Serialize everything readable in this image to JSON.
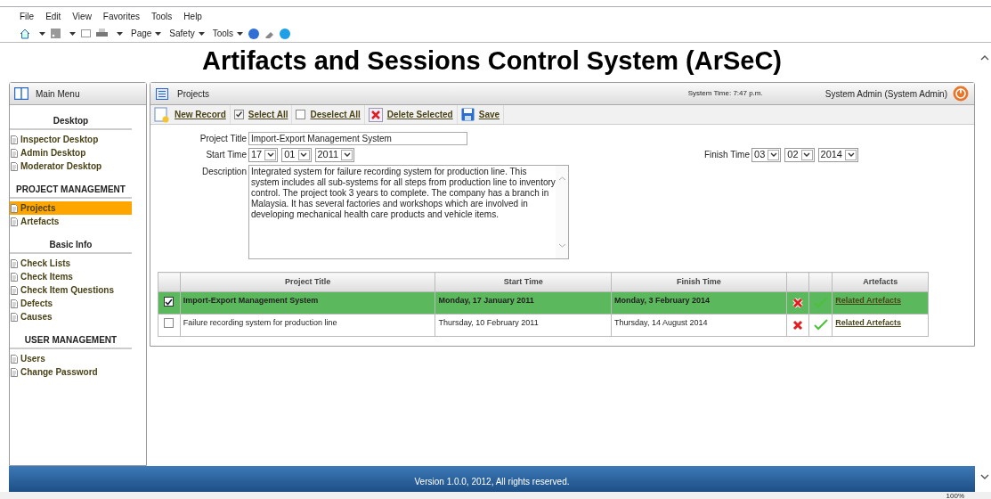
{
  "browser": {
    "menu": [
      "File",
      "Edit",
      "View",
      "Favorites",
      "Tools",
      "Help"
    ],
    "toolbar": [
      "Page",
      "Safety",
      "Tools"
    ],
    "zoom": "100%"
  },
  "page_title": "Artifacts and Sessions Control System (ArSeC)",
  "sidebar": {
    "title": "Main Menu",
    "sections": [
      {
        "heading": "Desktop",
        "items": [
          {
            "label": "Inspector Desktop",
            "selected": false
          },
          {
            "label": "Admin Desktop",
            "selected": false
          },
          {
            "label": "Moderator Desktop",
            "selected": false
          }
        ]
      },
      {
        "heading": "PROJECT MANAGEMENT",
        "items": [
          {
            "label": "Projects",
            "selected": true
          },
          {
            "label": "Artefacts",
            "selected": false
          }
        ]
      },
      {
        "heading": "Basic Info",
        "items": [
          {
            "label": "Check Lists",
            "selected": false
          },
          {
            "label": "Check Items",
            "selected": false
          },
          {
            "label": "Check Item Questions",
            "selected": false
          },
          {
            "label": "Defects",
            "selected": false
          },
          {
            "label": "Causes",
            "selected": false
          }
        ]
      },
      {
        "heading": "USER MANAGEMENT",
        "items": [
          {
            "label": "Users",
            "selected": false
          },
          {
            "label": "Change Password",
            "selected": false
          }
        ]
      }
    ]
  },
  "panel": {
    "title": "Projects",
    "system_time": "System Time: 7:47 p.m.",
    "user": "System Admin (System Admin)"
  },
  "actions": [
    {
      "kind": "new",
      "label": "New Record"
    },
    {
      "kind": "select",
      "label": "Select All"
    },
    {
      "kind": "deselect",
      "label": "Deselect All"
    },
    {
      "kind": "delete",
      "label": "Delete Selected"
    },
    {
      "kind": "save",
      "label": "Save"
    }
  ],
  "form": {
    "title_label": "Project Title",
    "title_value": "Import-Export Management System",
    "start_label": "Start Time",
    "start": [
      "17",
      "01",
      "2011"
    ],
    "finish_label": "Finish Time",
    "finish": [
      "03",
      "02",
      "2014"
    ],
    "description_label": "Description",
    "description": "Integrated system for failure recording system for production line. This system includes all sub-systems for all steps from production line to inventory control. The project took 3 years to complete. The company has a branch in Malaysia. It has several factories and workshops which are involved in developing mechanical health care products and vehicle items."
  },
  "table": {
    "columns": [
      "Project Title",
      "Start Time",
      "Finish Time",
      "Artefacts"
    ],
    "rows": [
      {
        "selected": true,
        "title": "Import-Export Management System",
        "start": "Monday, 17 January 2011",
        "finish": "Monday, 3 February 2014",
        "link": "Related Artefacts"
      },
      {
        "selected": false,
        "title": "Failure recording system for production line",
        "start": "Thursday, 10 February 2011",
        "finish": "Thursday, 14 August 2014",
        "link": "Related Artefacts"
      }
    ]
  },
  "footer": "Version 1.0.0, 2012, All rights reserved."
}
